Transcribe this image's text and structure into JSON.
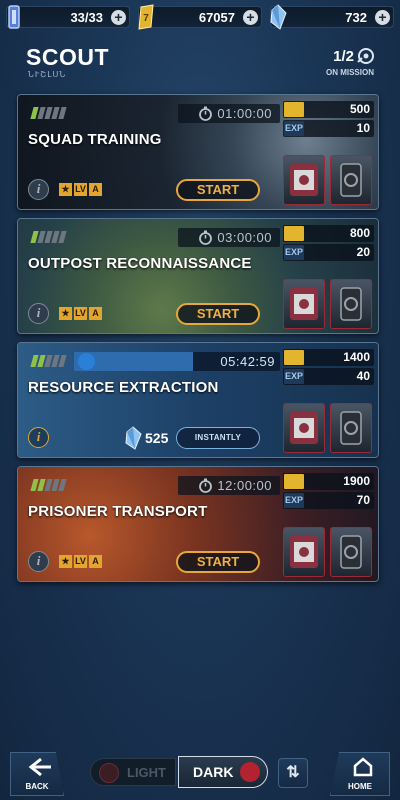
{
  "currencies": [
    {
      "name": "energy",
      "value": "33/33",
      "icon": "energy-cell-icon",
      "color": "#5a7fd9"
    },
    {
      "name": "credits",
      "value": "67057",
      "icon": "credits-icon",
      "color": "#e3b42e"
    },
    {
      "name": "crystals",
      "value": "732",
      "icon": "crystal-icon",
      "color": "#8fc3f2"
    }
  ],
  "header": {
    "title": "SCOUT",
    "subscript": "ՆՒՇԼՍՆ",
    "mission_count": "1/2",
    "mission_label": "ON MISSION"
  },
  "missions": [
    {
      "name": "SQUAD TRAINING",
      "duration": "01:00:00",
      "difficulty_filled": 1,
      "credits": "500",
      "exp_label": "EXP",
      "exp": "10",
      "action": "START",
      "state": "idle"
    },
    {
      "name": "OUTPOST RECONNAISSANCE",
      "duration": "03:00:00",
      "difficulty_filled": 1,
      "credits": "800",
      "exp_label": "EXP",
      "exp": "20",
      "action": "START",
      "state": "idle"
    },
    {
      "name": "RESOURCE EXTRACTION",
      "remaining": "05:42:59",
      "progress": 0.58,
      "difficulty_filled": 2,
      "credits": "1400",
      "exp_label": "EXP",
      "exp": "40",
      "crystal_cost": "525",
      "action": "INSTANTLY",
      "state": "running"
    },
    {
      "name": "PRISONER TRANSPORT",
      "duration": "12:00:00",
      "difficulty_filled": 2,
      "credits": "1900",
      "exp_label": "EXP",
      "exp": "70",
      "action": "START",
      "state": "idle"
    }
  ],
  "requirements": [
    "★",
    "LV",
    "A"
  ],
  "bottom": {
    "back_label": "BACK",
    "light_label": "LIGHT",
    "dark_label": "DARK",
    "home_label": "HOME"
  },
  "colors": {
    "accent_orange": "#e8a73a",
    "difficulty_green": "#8fc04a",
    "crate_red": "#9a2a35"
  }
}
